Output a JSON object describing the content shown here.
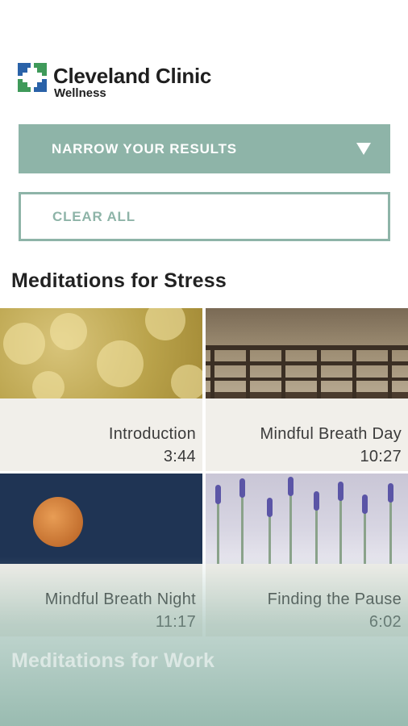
{
  "brand": {
    "name": "Cleveland Clinic",
    "sub": "Wellness"
  },
  "filters": {
    "narrow_label": "NARROW YOUR RESULTS",
    "clear_label": "CLEAR ALL"
  },
  "sections": [
    {
      "title": "Meditations for Stress",
      "items": [
        {
          "title": "Introduction",
          "duration": "3:44",
          "image": "golden-bokeh"
        },
        {
          "title": "Mindful Breath Day",
          "duration": "10:27",
          "image": "wooden-fence"
        },
        {
          "title": "Mindful Breath Night",
          "duration": "11:17",
          "image": "full-moon"
        },
        {
          "title": "Finding the Pause",
          "duration": "6:02",
          "image": "lavender-field"
        }
      ]
    },
    {
      "title": "Meditations for Work"
    }
  ],
  "colors": {
    "accent": "#8eb4a8",
    "logo_blue": "#2a62a8",
    "logo_green": "#3f9a5a"
  },
  "icons": {
    "dropdown": "caret-down-icon",
    "logo": "cleveland-clinic-logo-icon"
  }
}
